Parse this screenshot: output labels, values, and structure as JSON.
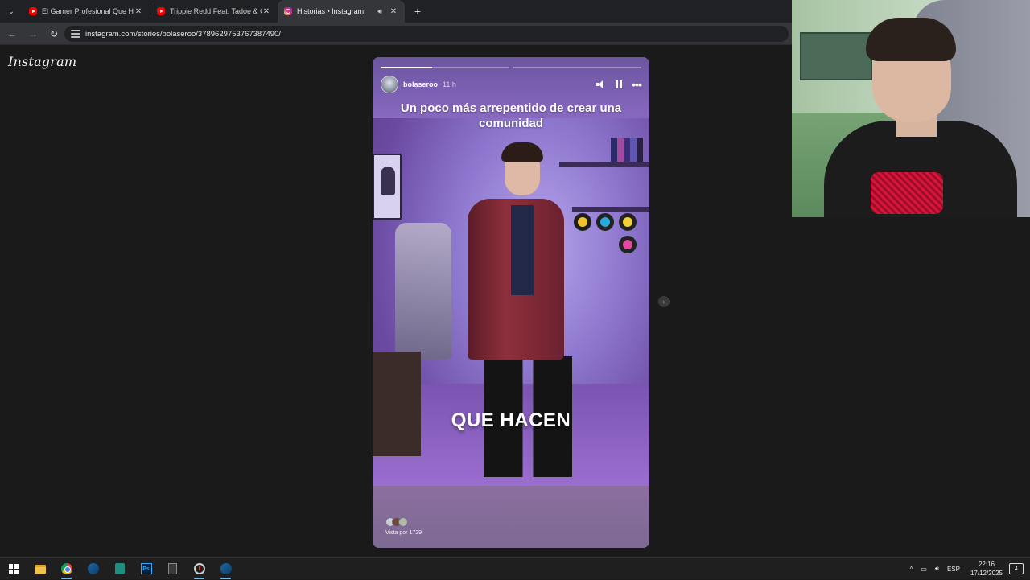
{
  "browser": {
    "tabs": [
      {
        "title": "El Gamer Profesional Que Hizo",
        "favicon": "youtube-icon"
      },
      {
        "title": "Trippie Redd Feat. Tadoe & Chi",
        "favicon": "youtube-icon"
      },
      {
        "title": "Historias • Instagram",
        "favicon": "instagram-icon",
        "active": true
      }
    ],
    "url": "instagram.com/stories/bolaseroo/3789629753767387490/"
  },
  "instagram": {
    "logo": "Instagram",
    "story": {
      "username": "bolaseroo",
      "age": "11 h",
      "caption_top": "Un poco más arrepentido de crear una comunidad",
      "caption_mid": "QUE HACEN",
      "views_label": "Vista por 1729",
      "progress": [
        0.4,
        0.0
      ],
      "accent": "#8a6cc6"
    }
  },
  "taskbar": {
    "apps": [
      "windows-start-icon",
      "file-explorer-icon",
      "chrome-icon",
      "steam-icon",
      "app-icon",
      "photoshop-icon",
      "calculator-icon",
      "obs-icon",
      "steam-icon"
    ],
    "language": "ESP",
    "time": "22:16",
    "date": "17/12/2025",
    "notifications": "4"
  }
}
